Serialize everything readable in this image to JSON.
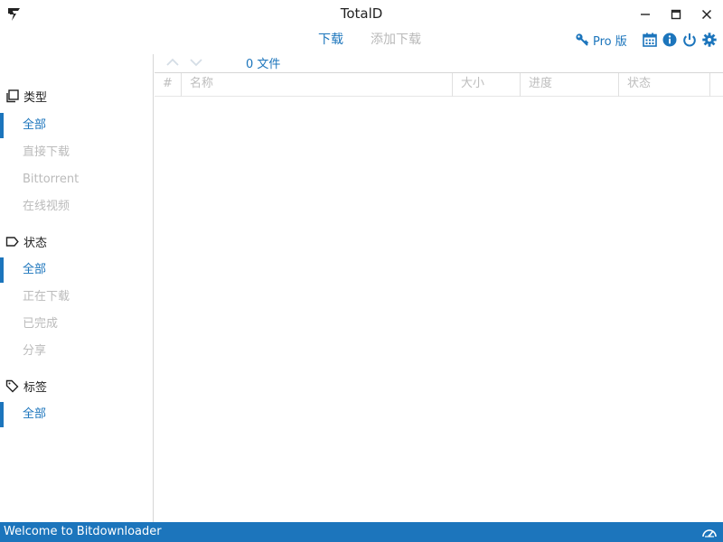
{
  "window": {
    "title": "TotalD",
    "controls": {
      "minimize": "minimize-icon",
      "maximize": "maximize-icon",
      "close": "close-icon"
    }
  },
  "topnav": {
    "tabs": [
      {
        "label": "下载",
        "active": true
      },
      {
        "label": "添加下载",
        "active": false
      }
    ],
    "pro_label": "Pro 版",
    "icons": [
      "key-icon",
      "calendar-icon",
      "info-icon",
      "power-icon",
      "gear-icon"
    ]
  },
  "sidebar": {
    "sections": [
      {
        "title": "类型",
        "icon": "copy-icon",
        "items": [
          {
            "label": "全部",
            "active": true
          },
          {
            "label": "直接下载",
            "active": false
          },
          {
            "label": "Bittorrent",
            "active": false
          },
          {
            "label": "在线视频",
            "active": false
          }
        ]
      },
      {
        "title": "状态",
        "icon": "label-icon",
        "items": [
          {
            "label": "全部",
            "active": true
          },
          {
            "label": "正在下载",
            "active": false
          },
          {
            "label": "已完成",
            "active": false
          },
          {
            "label": "分享",
            "active": false
          }
        ]
      },
      {
        "title": "标签",
        "icon": "tag-icon",
        "items": [
          {
            "label": "全部",
            "active": true
          }
        ]
      }
    ]
  },
  "content": {
    "file_count": "0 文件",
    "columns": [
      "#",
      "名称",
      "大小",
      "进度",
      "状态"
    ],
    "rows": []
  },
  "statusbar": {
    "text": "Welcome to Bitdownloader",
    "icon": "speedometer-icon"
  },
  "colors": {
    "accent": "#1c75bc",
    "muted": "#bbbbbb",
    "divider": "#d6d6d6"
  }
}
